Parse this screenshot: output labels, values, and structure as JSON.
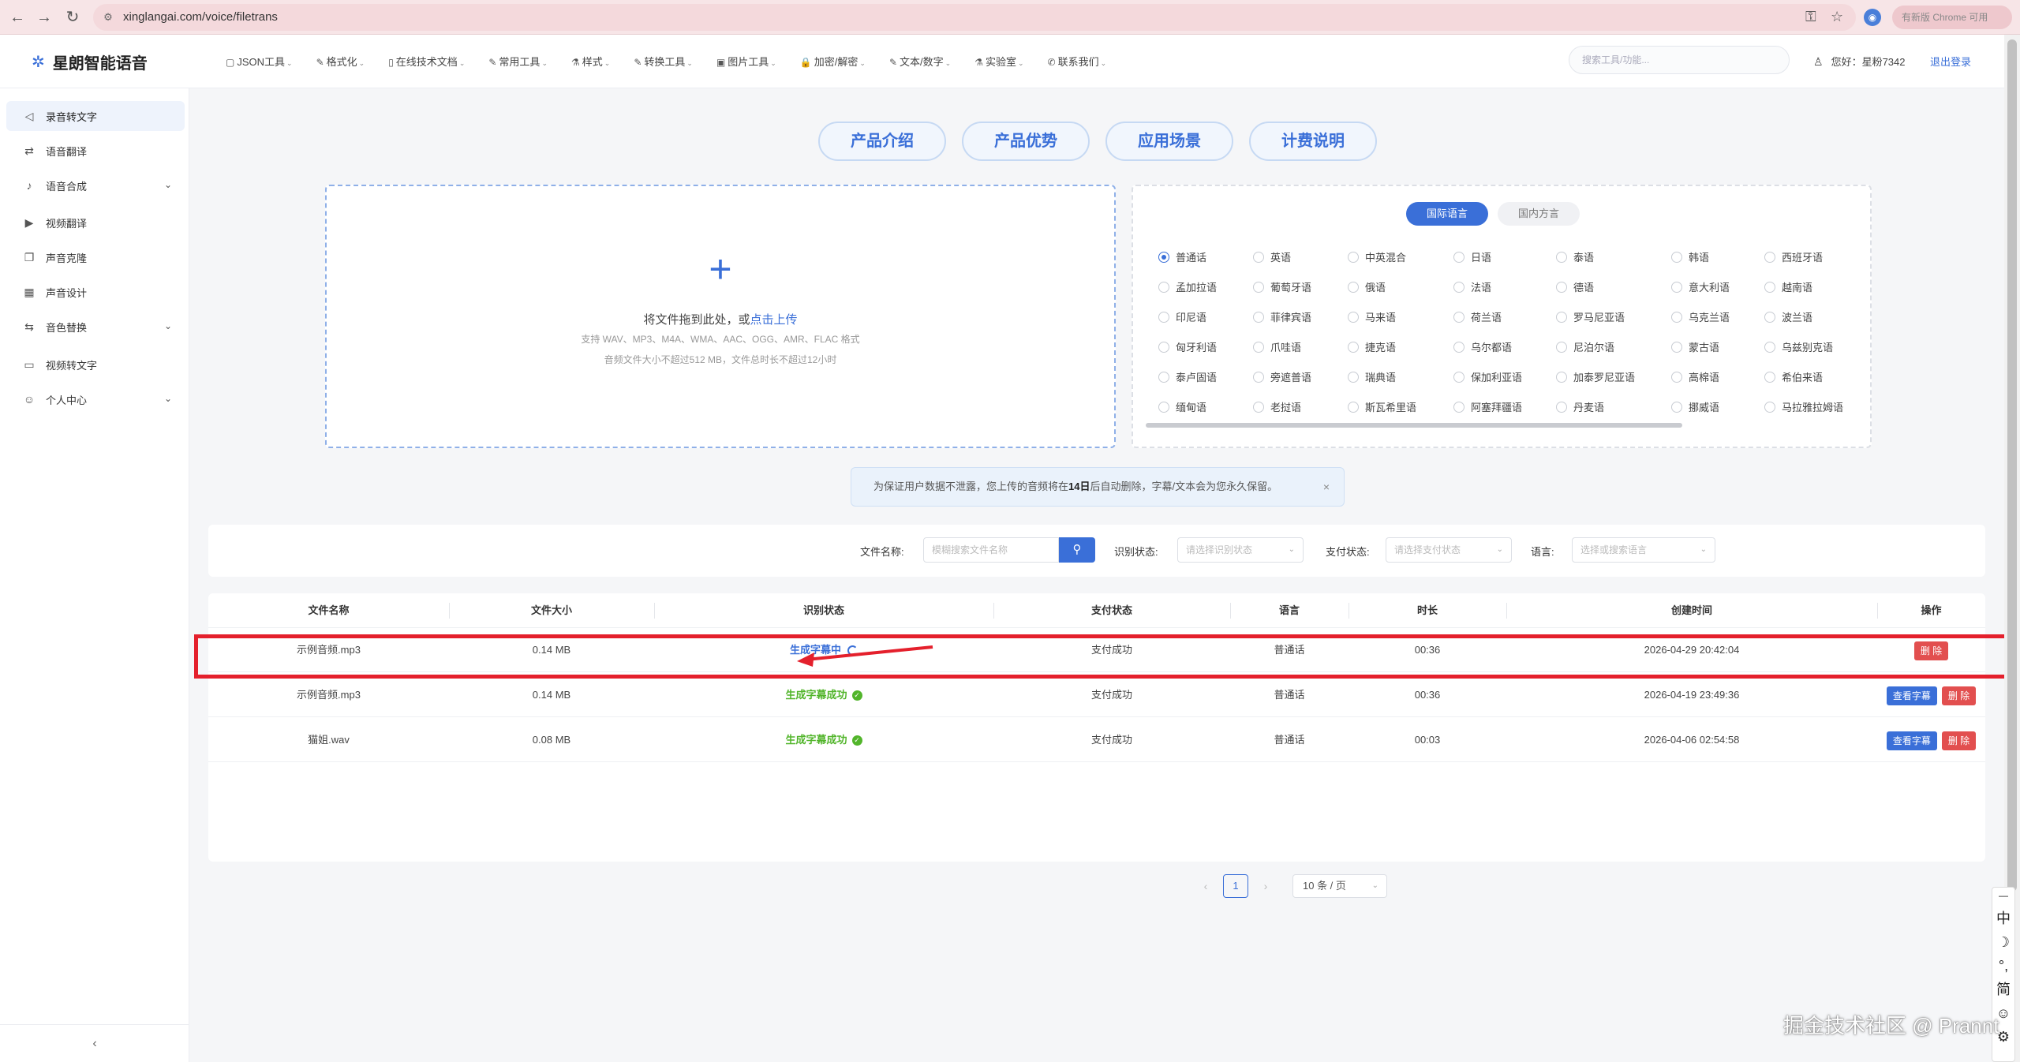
{
  "browser": {
    "url": "xinglangai.com/voice/filetrans",
    "update_label": "有新版 Chrome 可用"
  },
  "header": {
    "logo_text": "星朗智能语音",
    "nav": [
      {
        "label": "JSON工具",
        "icon": "▢"
      },
      {
        "label": "格式化",
        "icon": "✎"
      },
      {
        "label": "在线技术文档",
        "icon": "▯"
      },
      {
        "label": "常用工具",
        "icon": "✎"
      },
      {
        "label": "样式",
        "icon": "⚗"
      },
      {
        "label": "转换工具",
        "icon": "✎"
      },
      {
        "label": "图片工具",
        "icon": "▣"
      },
      {
        "label": "加密/解密",
        "icon": "🔒"
      },
      {
        "label": "文本/数字",
        "icon": "✎"
      },
      {
        "label": "实验室",
        "icon": "⚗"
      },
      {
        "label": "联系我们",
        "icon": "✆"
      }
    ],
    "search_placeholder": "搜索工具/功能...",
    "user_greeting": "您好：星粉7342",
    "logout_label": "退出登录"
  },
  "sidebar": {
    "items": [
      {
        "label": "录音转文字",
        "icon": "◁",
        "expand": false,
        "active": true
      },
      {
        "label": "语音翻译",
        "icon": "⇄",
        "expand": false,
        "active": false
      },
      {
        "label": "语音合成",
        "icon": "♪",
        "expand": true,
        "active": false
      },
      {
        "label": "视频翻译",
        "icon": "▶",
        "expand": false,
        "active": false
      },
      {
        "label": "声音克隆",
        "icon": "❐",
        "expand": false,
        "active": false
      },
      {
        "label": "声音设计",
        "icon": "▦",
        "expand": false,
        "active": false
      },
      {
        "label": "音色替换",
        "icon": "⇆",
        "expand": true,
        "active": false
      },
      {
        "label": "视频转文字",
        "icon": "▭",
        "expand": false,
        "active": false
      },
      {
        "label": "个人中心",
        "icon": "☺",
        "expand": true,
        "active": false
      }
    ],
    "collapse_icon": "‹"
  },
  "topbuttons": [
    "产品介绍",
    "产品优势",
    "应用场景",
    "计费说明"
  ],
  "upload": {
    "plus": "+",
    "drag_text": "将文件拖到此处，或",
    "click_text": "点击上传",
    "formats": "支持 WAV、MP3、M4A、WMA、AAC、OGG、AMR、FLAC 格式",
    "limits": "音频文件大小不超过512 MB，文件总时长不超过12小时"
  },
  "languages": {
    "tabs": [
      "国际语言",
      "国内方言"
    ],
    "selected": "普通话",
    "rows": [
      [
        "普通话",
        "英语",
        "中英混合",
        "日语",
        "泰语",
        "韩语",
        "西班牙语"
      ],
      [
        "孟加拉语",
        "葡萄牙语",
        "俄语",
        "法语",
        "德语",
        "意大利语",
        "越南语"
      ],
      [
        "印尼语",
        "菲律宾语",
        "马来语",
        "荷兰语",
        "罗马尼亚语",
        "乌克兰语",
        "波兰语"
      ],
      [
        "匈牙利语",
        "爪哇语",
        "捷克语",
        "乌尔都语",
        "尼泊尔语",
        "蒙古语",
        "乌兹别克语"
      ],
      [
        "泰卢固语",
        "旁遮普语",
        "瑞典语",
        "保加利亚语",
        "加泰罗尼亚语",
        "高棉语",
        "希伯来语"
      ],
      [
        "缅甸语",
        "老挝语",
        "斯瓦希里语",
        "阿塞拜疆语",
        "丹麦语",
        "挪威语",
        "马拉雅拉姆语"
      ]
    ]
  },
  "notice": {
    "prefix": "为保证用户数据不泄露，您上传的音频将在",
    "bold": "14日",
    "suffix": "后自动删除，字幕/文本会为您永久保留。",
    "close": "×"
  },
  "filters": {
    "filename_label": "文件名称:",
    "filename_placeholder": "模糊搜索文件名称",
    "status_label": "识别状态:",
    "status_placeholder": "请选择识别状态",
    "pay_label": "支付状态:",
    "pay_placeholder": "请选择支付状态",
    "lang_label": "语言:",
    "lang_placeholder": "选择或搜索语言"
  },
  "table": {
    "columns": [
      "文件名称",
      "文件大小",
      "识别状态",
      "支付状态",
      "语言",
      "时长",
      "创建时间",
      "操作"
    ],
    "rows": [
      {
        "name": "示例音频.mp3",
        "size": "0.14 MB",
        "status": "生成字幕中",
        "status_type": "progress",
        "pay": "支付成功",
        "lang": "普通话",
        "duration": "00:36",
        "created": "2026-04-29 20:42:04",
        "actions": [
          "删 除"
        ]
      },
      {
        "name": "示例音频.mp3",
        "size": "0.14 MB",
        "status": "生成字幕成功",
        "status_type": "success",
        "pay": "支付成功",
        "lang": "普通话",
        "duration": "00:36",
        "created": "2026-04-19 23:49:36",
        "actions": [
          "查看字幕",
          "删 除"
        ]
      },
      {
        "name": "猫姐.wav",
        "size": "0.08 MB",
        "status": "生成字幕成功",
        "status_type": "success",
        "pay": "支付成功",
        "lang": "普通话",
        "duration": "00:03",
        "created": "2026-04-06 02:54:58",
        "actions": [
          "查看字幕",
          "删 除"
        ]
      }
    ]
  },
  "pagination": {
    "prev": "‹",
    "page": "1",
    "next": "›",
    "page_size": "10 条 / 页"
  },
  "ime": [
    "中",
    "☽",
    "°,",
    "简",
    "☺",
    "⚙"
  ],
  "watermark": "掘金技术社区 @ Prannt"
}
